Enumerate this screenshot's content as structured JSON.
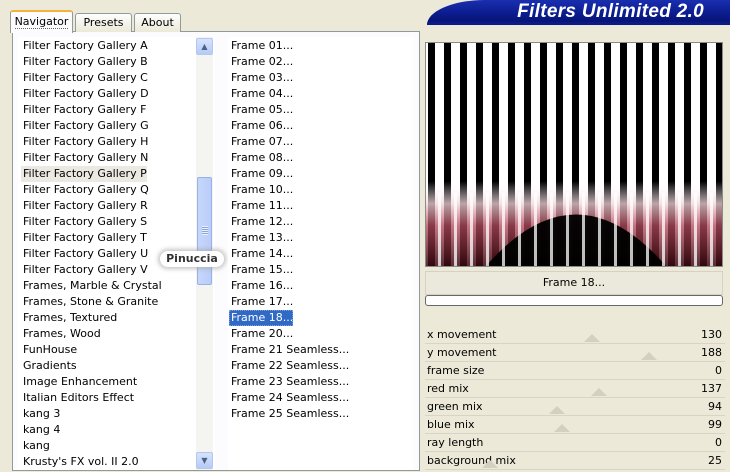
{
  "tabs": [
    {
      "label": "Navigator",
      "active": true
    },
    {
      "label": "Presets",
      "active": false
    },
    {
      "label": "About",
      "active": false
    }
  ],
  "banner": {
    "title": "Filters Unlimited 2.0"
  },
  "watermark": "Pinuccia",
  "categories": {
    "items": [
      "Filter Factory Gallery A",
      "Filter Factory Gallery B",
      "Filter Factory Gallery C",
      "Filter Factory Gallery D",
      "Filter Factory Gallery F",
      "Filter Factory Gallery G",
      "Filter Factory Gallery H",
      "Filter Factory Gallery N",
      "Filter Factory Gallery P",
      "Filter Factory Gallery Q",
      "Filter Factory Gallery R",
      "Filter Factory Gallery S",
      "Filter Factory Gallery T",
      "Filter Factory Gallery U",
      "Filter Factory Gallery V",
      "Frames, Marble & Crystal",
      "Frames, Stone & Granite",
      "Frames, Textured",
      "Frames, Wood",
      "FunHouse",
      "Gradients",
      "Image Enhancement",
      "Italian Editors Effect",
      "kang 3",
      "kang 4",
      "kang",
      "Krusty's FX vol. II 2.0"
    ],
    "selected_index": 8
  },
  "filters": {
    "items": [
      "Frame 01...",
      "Frame 02...",
      "Frame 03...",
      "Frame 04...",
      "Frame 05...",
      "Frame 06...",
      "Frame 07...",
      "Frame 08...",
      "Frame 09...",
      "Frame 10...",
      "Frame 11...",
      "Frame 12...",
      "Frame 13...",
      "Frame 14...",
      "Frame 15...",
      "Frame 16...",
      "Frame 17...",
      "Frame 18...",
      "Frame 20...",
      "Frame 21 Seamless...",
      "Frame 22 Seamless...",
      "Frame 23 Seamless...",
      "Frame 24 Seamless...",
      "Frame 25 Seamless..."
    ],
    "selected_index": 17
  },
  "preview": {
    "filter_name": "Frame 18..."
  },
  "params": [
    {
      "label": "x movement",
      "value": 130,
      "max": 255
    },
    {
      "label": "y movement",
      "value": 188,
      "max": 255
    },
    {
      "label": "frame size",
      "value": 0,
      "max": 255
    },
    {
      "label": "red mix",
      "value": 137,
      "max": 255
    },
    {
      "label": "green mix",
      "value": 94,
      "max": 255
    },
    {
      "label": "blue mix",
      "value": 99,
      "max": 255
    },
    {
      "label": "ray length",
      "value": 0,
      "max": 255
    },
    {
      "label": "background mix",
      "value": 25,
      "max": 255
    }
  ],
  "colors": {
    "selection": "#316ac5",
    "banner": "#0a1a8a",
    "preview_tint": "#7a1a2a"
  }
}
